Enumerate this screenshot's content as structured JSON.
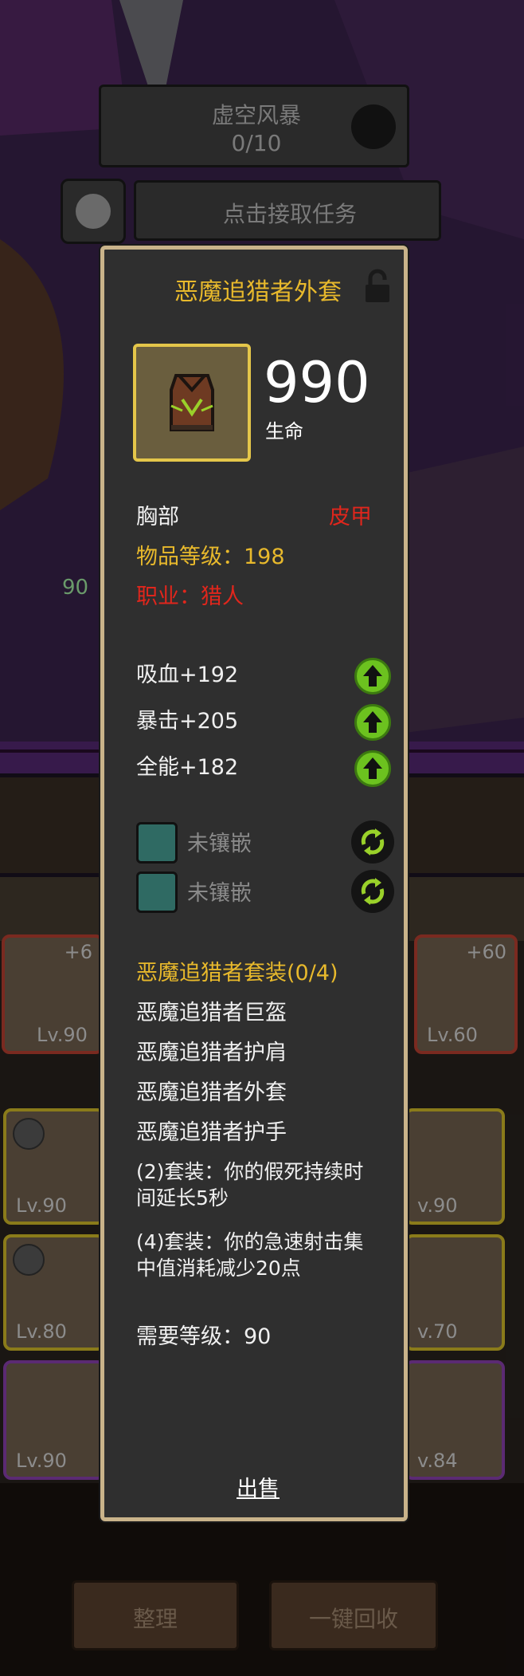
{
  "background": {
    "quest_name": "虚空风暴",
    "quest_progress": "0/10",
    "task_button_label": "点击接取任务",
    "alert_icon": "exclamation-icon",
    "slot_badge_left": "90",
    "equipped_slots": [
      {
        "level": "Lv.90",
        "plus": "+6"
      },
      {
        "level": "Lv.60",
        "plus": "+60"
      }
    ],
    "inventory_levels": [
      "Lv.90",
      "v.90",
      "Lv.80",
      "v.70",
      "Lv.90",
      "v.84"
    ],
    "sort_button_label": "整理",
    "recycle_button_label": "一键回收"
  },
  "item": {
    "name": "恶魔追猎者外套",
    "lock_icon": "padlock-icon",
    "main_stat_value": "990",
    "main_stat_name": "生命",
    "slot": "胸部",
    "armor_type": "皮甲",
    "item_level": "物品等级：198",
    "class_req": "职业：猎人",
    "secondary_stats": [
      "吸血+192",
      "暴击+205",
      "全能+182"
    ],
    "sockets": [
      "未镶嵌",
      "未镶嵌"
    ],
    "set_name": "恶魔追猎者套装(0/4)",
    "set_pieces": [
      "恶魔追猎者巨盔",
      "恶魔追猎者护肩",
      "恶魔追猎者外套",
      "恶魔追猎者护手"
    ],
    "set_bonus_2": "(2)套装：你的假死持续时间延长5秒",
    "set_bonus_4": "(4)套装：你的急速射击集中值消耗减少20点",
    "required_level": "需要等级：90",
    "sell_label": "出售"
  },
  "colors": {
    "title_gold": "#e8b92c",
    "requirement_red": "#e0261c",
    "upgrade_green": "#6cc21f",
    "panel_border": "#c9b38a",
    "panel_bg": "#2f2f2f"
  }
}
